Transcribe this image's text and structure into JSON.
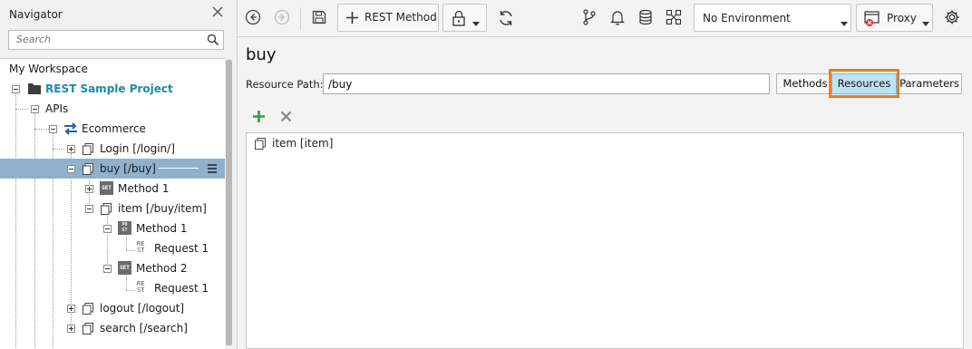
{
  "navigator": {
    "title": "Navigator",
    "search_placeholder": "Search",
    "workspace": "My Workspace",
    "tree": {
      "project": "REST Sample Project",
      "apis": "APIs",
      "ecommerce": "Ecommerce",
      "login": "Login [/login/]",
      "buy": "buy [/buy]",
      "buy_method1": "Method 1",
      "item": "item [/buy/item]",
      "item_method1": "Method 1",
      "request1a": "Request 1",
      "item_method2": "Method 2",
      "request1b": "Request 1",
      "logout": "logout [/logout]",
      "search": "search [/search]"
    },
    "badges": {
      "get": "GET",
      "post_lines": [
        "PO",
        "ST"
      ],
      "rest_lines": [
        "RE",
        "ST"
      ]
    }
  },
  "toolbar": {
    "rest_method_label": "REST Method",
    "environment": "No Environment",
    "proxy_label": "Proxy"
  },
  "main": {
    "title": "buy",
    "resource_path_label": "Resource Path:",
    "resource_path_value": "/buy",
    "tabs": [
      "Methods",
      "Resources",
      "Parameters"
    ],
    "active_tab": "Resources",
    "resources": [
      {
        "label": "item [item]"
      }
    ]
  },
  "colors": {
    "project_text": "#1a8aa8",
    "selected_row": "#8fb1cc",
    "active_tab_bg": "#bfe3f5",
    "highlight_border": "#ee7d1a",
    "add_green": "#2e9e3e",
    "delete_grey": "#8a8a8a",
    "ecommerce_icon": "#2a5da8"
  }
}
